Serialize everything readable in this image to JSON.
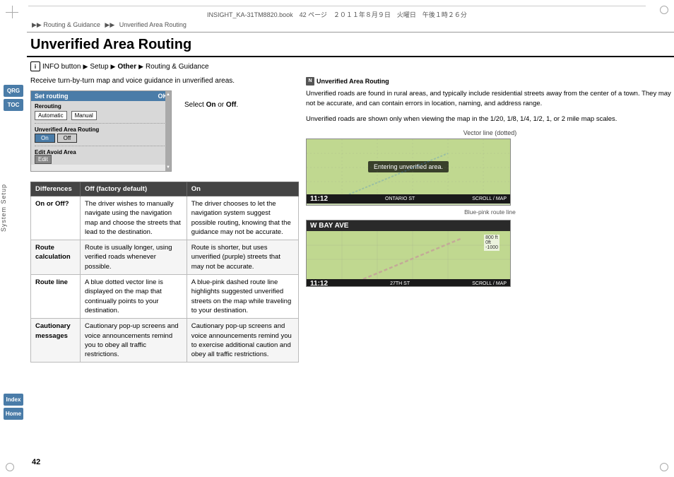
{
  "page": {
    "number": "42",
    "file_info": "INSIGHT_KA-31TM8820.book　42 ページ　２０１１年８月９日　火曜日　午後１時２６分"
  },
  "breadcrumb": {
    "items": [
      "▶▶ Routing & Guidance",
      "▶▶ Unverified Area Routing"
    ]
  },
  "title": "Unverified Area Routing",
  "info_line": {
    "icon": "i",
    "text": "INFO button",
    "steps": [
      "Setup",
      "Other",
      "Routing & Guidance"
    ]
  },
  "receive_text": "Receive turn-by-turn map and voice guidance in unverified areas.",
  "select_text": "Select On or Off.",
  "nav_screenshot": {
    "title": "Set routing",
    "ok_btn": "OK",
    "rows": [
      {
        "label": "Rerouting",
        "value": ""
      },
      {
        "col1": "Automatic",
        "col2": "Manual"
      }
    ],
    "unverified_label": "Unverified Area Routing",
    "on_btn": "On",
    "off_btn": "Off",
    "edit_avoid_label": "Edit Avoid Area",
    "edit_btn": "Edit"
  },
  "table": {
    "headers": [
      "Differences",
      "Off (factory default)",
      "On"
    ],
    "rows": [
      {
        "diff": "On or Off?",
        "off": "The driver wishes to manually navigate using the navigation map and choose the streets that lead to the destination.",
        "on": "The driver chooses to let the navigation system suggest possible routing, knowing that the guidance may not be accurate."
      },
      {
        "diff": "Route calculation",
        "off": "Route is usually longer, using verified roads whenever possible.",
        "on": "Route is shorter, but uses unverified (purple) streets that may not be accurate."
      },
      {
        "diff": "Route line",
        "off": "A blue dotted vector line is displayed on the map that continually points to your destination.",
        "on": "A blue-pink dashed route line highlights suggested unverified streets on the map while traveling to your destination."
      },
      {
        "diff": "Cautionary messages",
        "off": "Cautionary pop-up screens and voice announcements remind you to obey all traffic restrictions.",
        "on": "Cautionary pop-up screens and voice announcements remind you to exercise additional caution and obey all traffic restrictions."
      }
    ]
  },
  "right_section": {
    "title": "Unverified Area Routing",
    "icon": "N",
    "paragraphs": [
      "Unverified roads are found in rural areas, and typically include residential streets away from the center of a town. They may not be accurate, and can contain errors in location, naming, and address range.",
      "Unverified roads are shown only when viewing the map in the 1/20, 1/8, 1/4, 1/2, 1, or 2 mile map scales."
    ],
    "map1": {
      "caption": "Vector line (dotted)",
      "overlay_text": "Entering unverified area.",
      "footer_time": "11:12",
      "footer_street": "ONTARIO ST",
      "footer_right": "SCROLL / MAP"
    },
    "map2": {
      "caption": "Blue-pink route line",
      "footer_time": "11:12",
      "footer_street": "27TH ST",
      "footer_right": "SCROLL / MAP",
      "header_street": "W BAY AVE"
    }
  },
  "sidebar": {
    "qrg_label": "QRG",
    "toc_label": "TOC",
    "system_setup_label": "System Setup",
    "index_label": "Index",
    "home_label": "Home"
  }
}
